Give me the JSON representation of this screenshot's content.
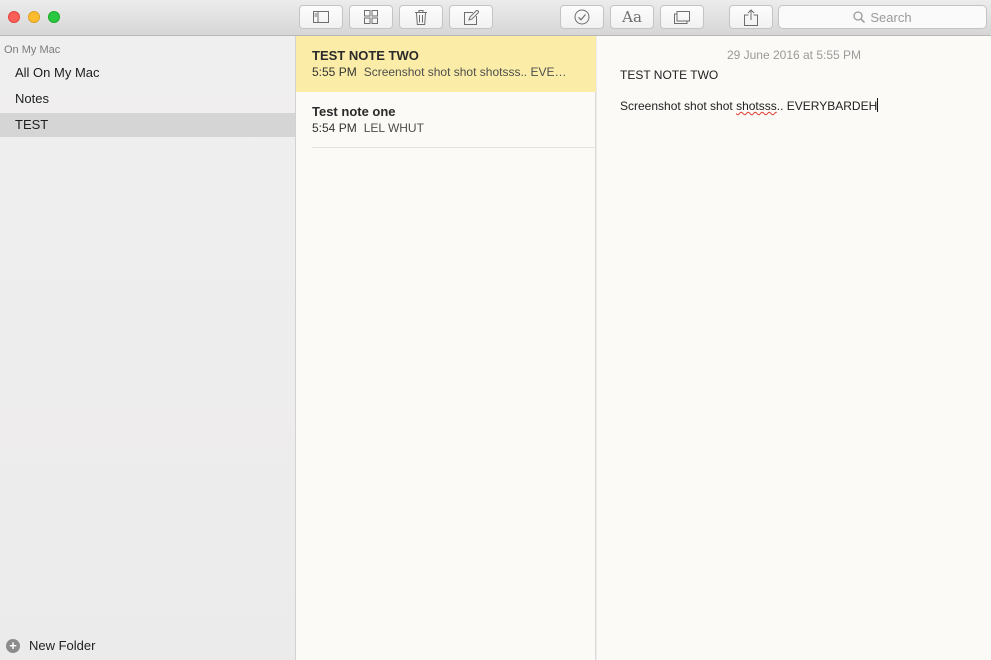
{
  "window": {
    "toolbar": {
      "icons": [
        "sidebar-toggle-icon",
        "grid-view-icon",
        "trash-icon",
        "compose-icon",
        "checkmark-circle-icon",
        "font-format-icon",
        "attachments-browser-icon",
        "share-icon"
      ],
      "format_label": "Aa"
    },
    "search": {
      "placeholder": "Search"
    }
  },
  "sidebar": {
    "section_header": "On My Mac",
    "items": [
      {
        "label": "All On My Mac",
        "selected": false
      },
      {
        "label": "Notes",
        "selected": false
      },
      {
        "label": "TEST",
        "selected": true
      }
    ],
    "new_folder_label": "New Folder"
  },
  "notes_list": [
    {
      "title": "TEST NOTE TWO",
      "time": "5:55 PM",
      "preview": "Screenshot shot shot shotsss.. EVE…",
      "selected": true
    },
    {
      "title": "Test note one",
      "time": "5:54 PM",
      "preview": "LEL WHUT",
      "selected": false
    }
  ],
  "editor": {
    "date": "29 June 2016 at 5:55 PM",
    "title": "TEST NOTE TWO",
    "body_before": "Screenshot shot shot ",
    "body_misspelled": "shotsss",
    "body_after": ".. EVERYBARDEH"
  },
  "colors": {
    "selected_note": "#fbeda7",
    "selected_folder": "#d5d5d5",
    "spellcheck": "#e0392e"
  }
}
